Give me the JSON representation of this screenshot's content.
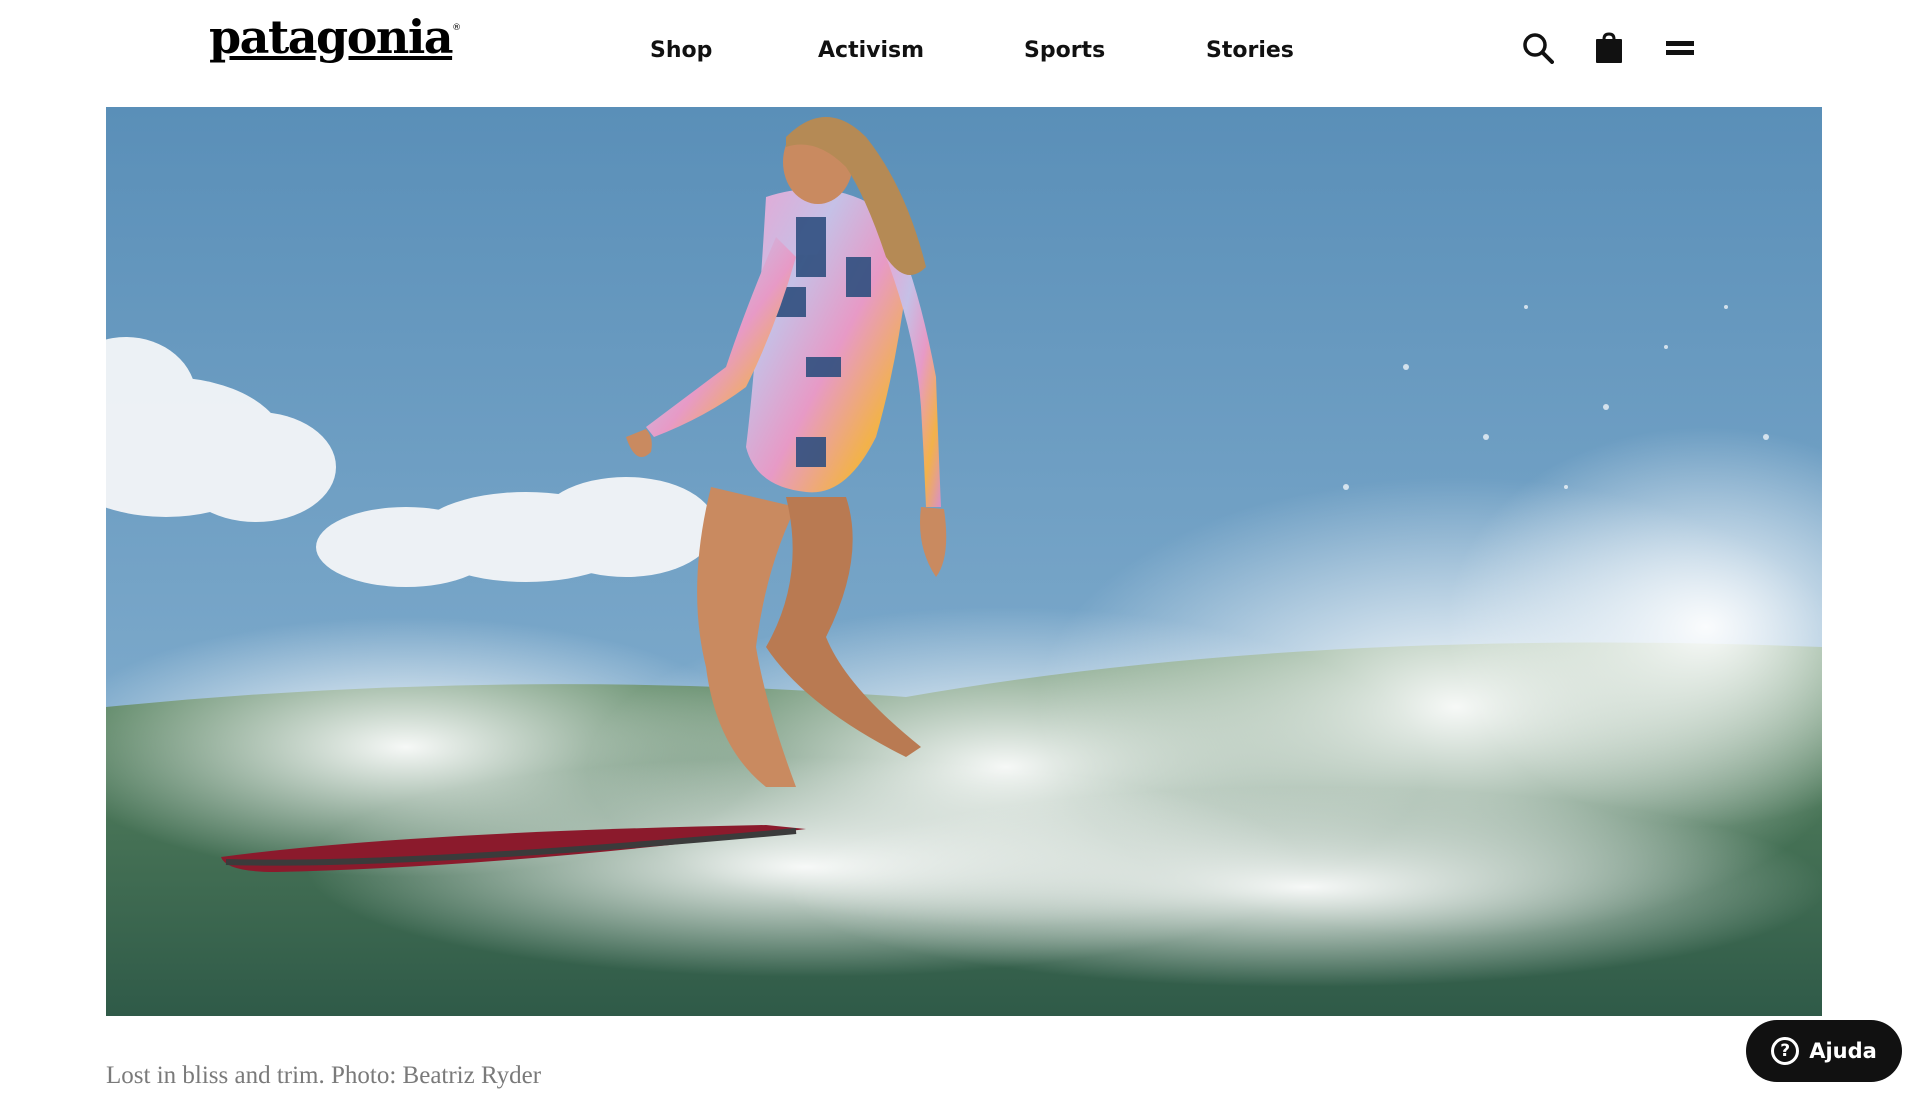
{
  "brand": {
    "logo_text": "patagonia",
    "registered": "®"
  },
  "nav": {
    "items": [
      {
        "label": "Shop"
      },
      {
        "label": "Activism"
      },
      {
        "label": "Sports"
      },
      {
        "label": "Stories"
      }
    ]
  },
  "header_icons": [
    "search-icon",
    "shopping-bag-icon",
    "menu-icon"
  ],
  "hero": {
    "caption": "Lost in bliss and trim. Photo: Beatriz Ryder"
  },
  "help": {
    "label": "Ajuda",
    "icon": "question-icon"
  },
  "colors": {
    "text": "#111111",
    "caption": "#7a7a7a",
    "help_bg": "#111111",
    "sky": "#5f97c2",
    "sea": "#3f6f4c"
  }
}
